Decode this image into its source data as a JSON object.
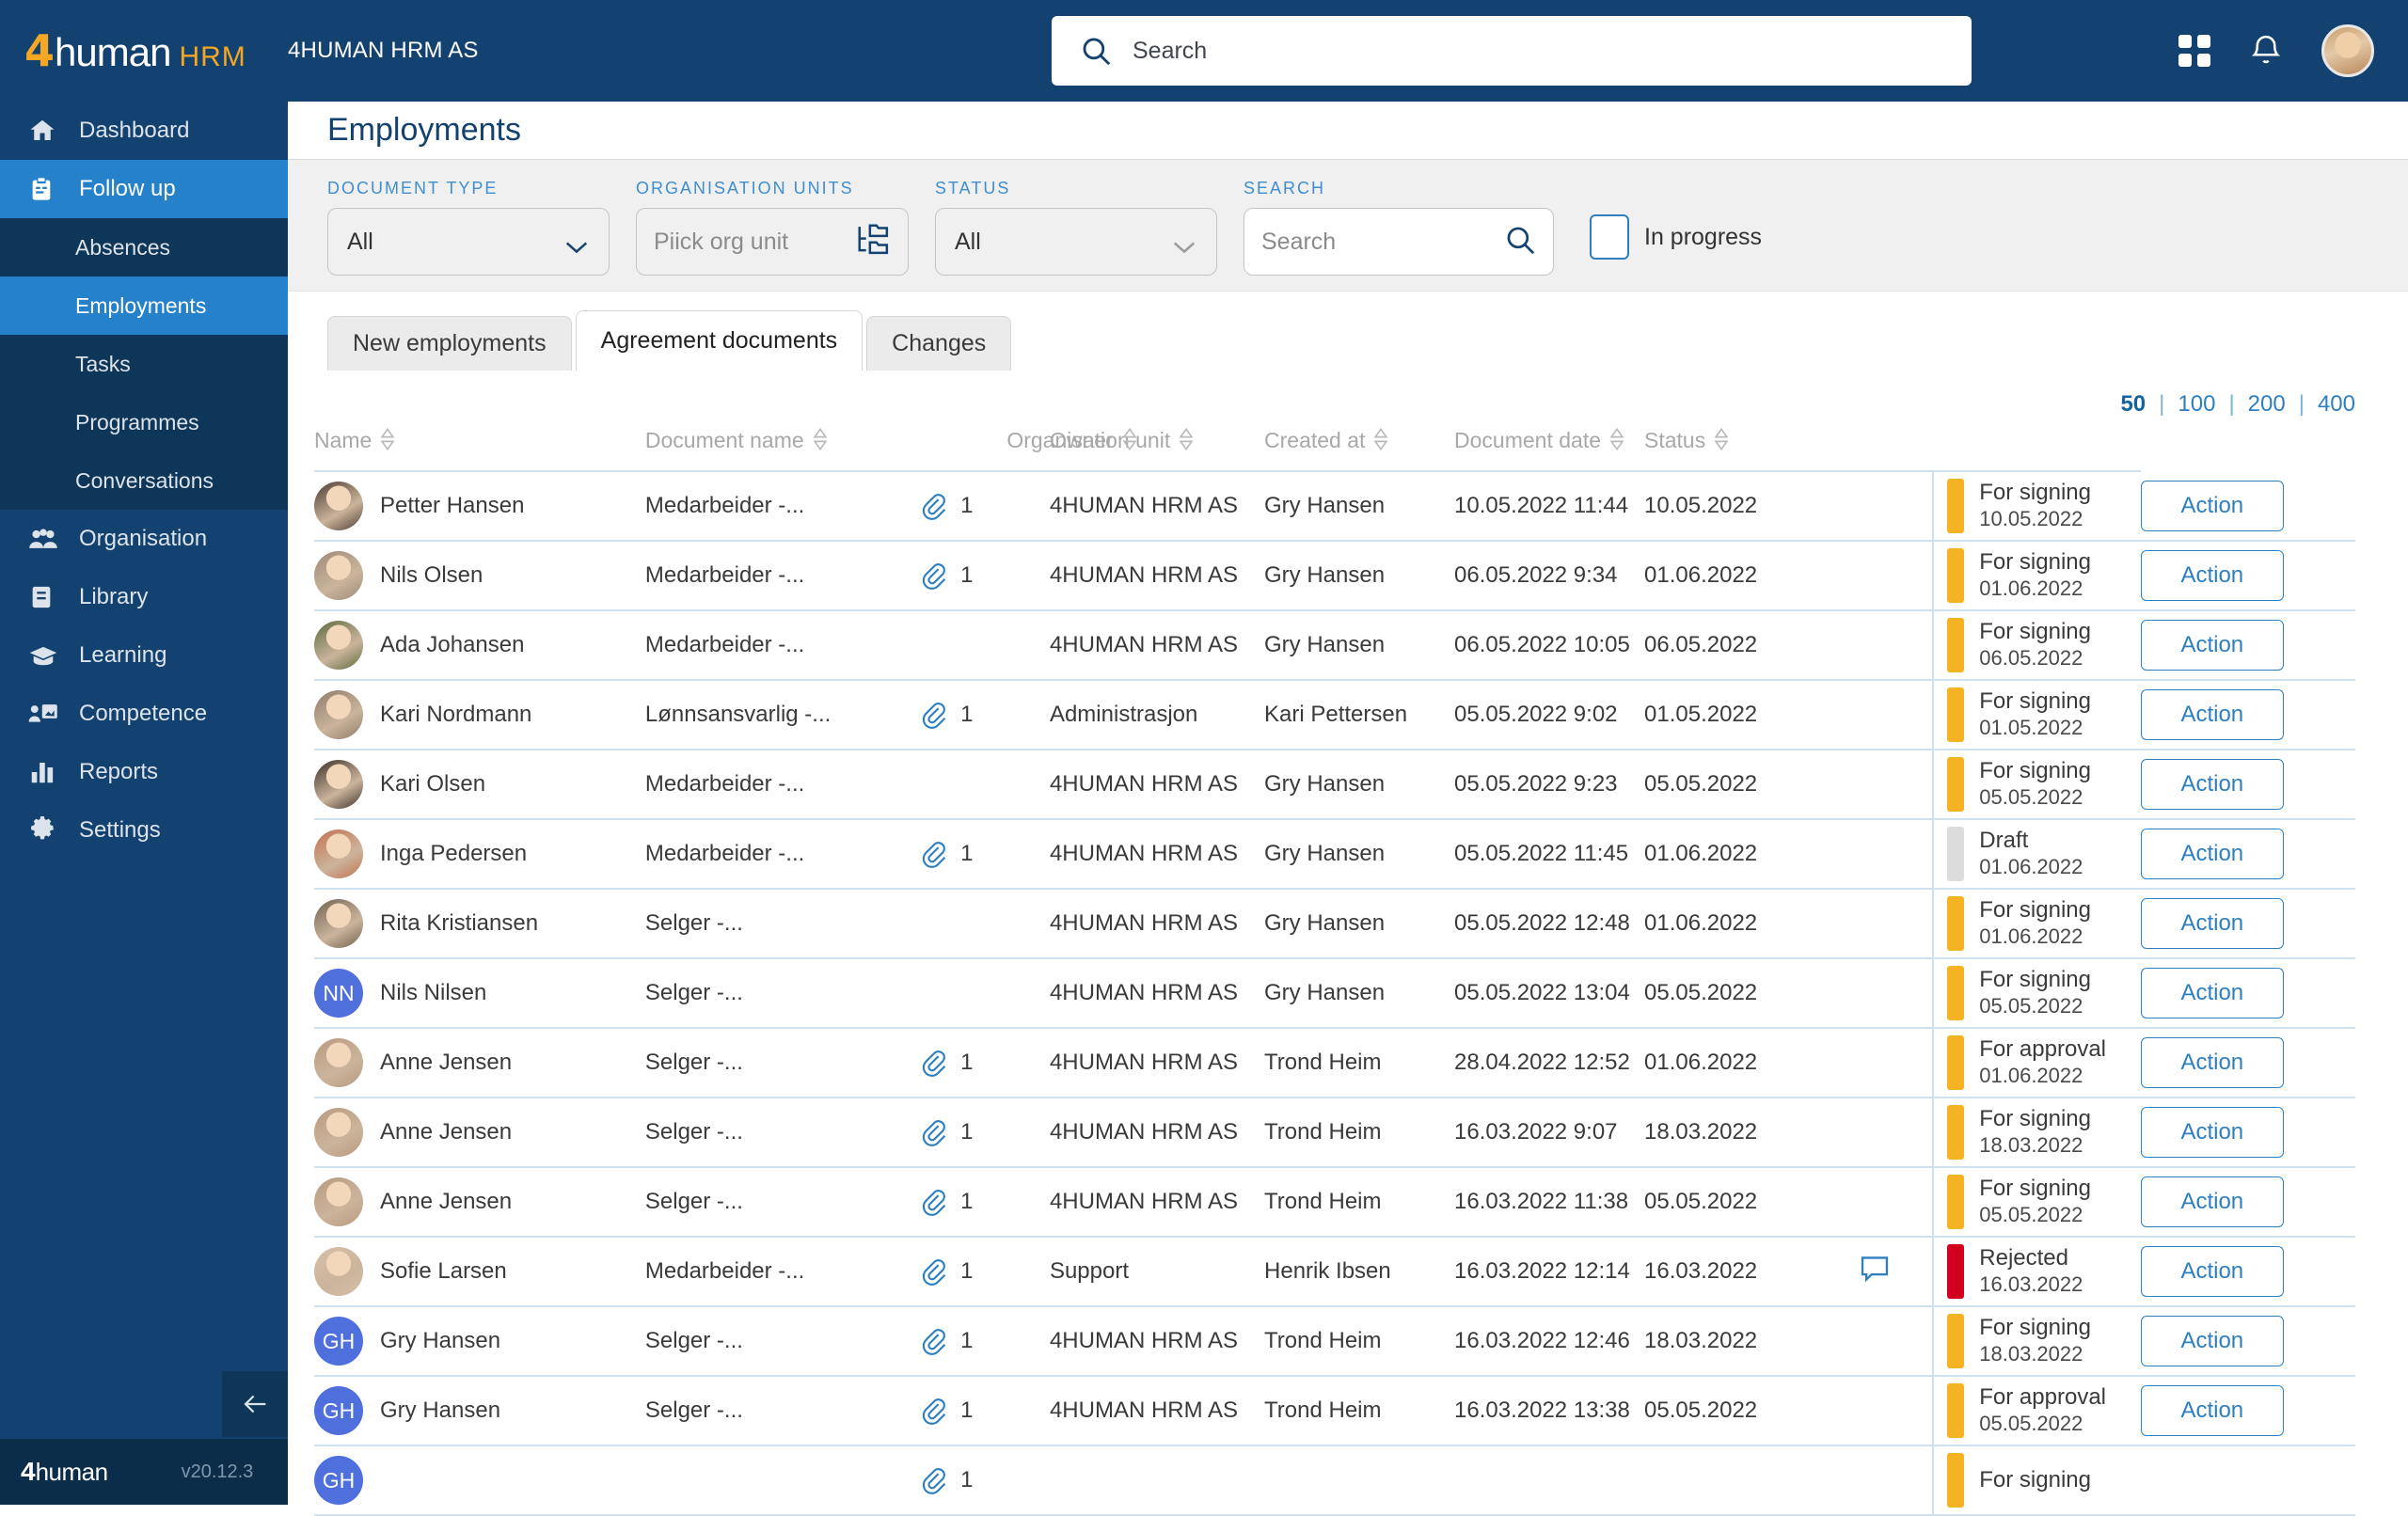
{
  "app": {
    "logo_4": "4",
    "logo_human": "human",
    "logo_hrm": "HRM",
    "org_name": "4HUMAN HRM AS",
    "version": "v20.12.3",
    "footer_logo_4": "4",
    "footer_logo_human": "human"
  },
  "topbar": {
    "search_placeholder": "Search",
    "search_value": ""
  },
  "sidebar": {
    "items": [
      {
        "label": "Dashboard",
        "icon": "home-icon",
        "active": false
      },
      {
        "label": "Follow up",
        "icon": "clipboard-icon",
        "active": true
      },
      {
        "label": "Organisation",
        "icon": "people-icon",
        "active": false
      },
      {
        "label": "Library",
        "icon": "book-icon",
        "active": false
      },
      {
        "label": "Learning",
        "icon": "graduation-cap-icon",
        "active": false
      },
      {
        "label": "Competence",
        "icon": "presentation-icon",
        "active": false
      },
      {
        "label": "Reports",
        "icon": "bar-chart-icon",
        "active": false
      },
      {
        "label": "Settings",
        "icon": "gear-icon",
        "active": false
      }
    ],
    "sub_items": [
      {
        "label": "Absences",
        "active": false
      },
      {
        "label": "Employments",
        "active": true
      },
      {
        "label": "Tasks",
        "active": false
      },
      {
        "label": "Programmes",
        "active": false
      },
      {
        "label": "Conversations",
        "active": false
      }
    ]
  },
  "page": {
    "title": "Employments"
  },
  "filters": {
    "document_type": {
      "label": "DOCUMENT TYPE",
      "value": "All"
    },
    "organisation_units": {
      "label": "ORGANISATION UNITS",
      "placeholder": "Piick org unit",
      "value": ""
    },
    "status": {
      "label": "STATUS",
      "value": "All"
    },
    "search": {
      "label": "SEARCH",
      "placeholder": "Search",
      "value": ""
    },
    "in_progress": {
      "label": "In progress",
      "checked": false
    }
  },
  "tabs": [
    {
      "label": "New  employments",
      "active": false
    },
    {
      "label": "Agreement documents",
      "active": true
    },
    {
      "label": "Changes",
      "active": false
    }
  ],
  "pager": {
    "options": [
      "50",
      "100",
      "200",
      "400"
    ],
    "selected": "50",
    "separator": "|"
  },
  "table": {
    "columns": [
      "Name",
      "Document name",
      "Organisation unit",
      "Owner",
      "Created at",
      "Document date",
      "Status"
    ],
    "rows": [
      {
        "avatar_type": "photo",
        "avatar_tone": "#4b3a30",
        "name": "Petter Hansen",
        "document_name": "Medarbeider -...",
        "attachments": "1",
        "has_attachment": true,
        "organisation_unit": "4HUMAN HRM AS",
        "owner": "Gry Hansen",
        "created_at": "10.05.2022 11:44",
        "document_date": "10.05.2022",
        "has_comment": false,
        "status_label": "For signing",
        "status_date": "10.05.2022",
        "status_color": "#f5b323",
        "action": "Action"
      },
      {
        "avatar_type": "photo",
        "avatar_tone": "#9c8a78",
        "name": "Nils Olsen",
        "document_name": "Medarbeider -...",
        "attachments": "1",
        "has_attachment": true,
        "organisation_unit": "4HUMAN HRM AS",
        "owner": "Gry Hansen",
        "created_at": "06.05.2022 9:34",
        "document_date": "01.06.2022",
        "has_comment": false,
        "status_label": "For signing",
        "status_date": "01.06.2022",
        "status_color": "#f5b323",
        "action": "Action"
      },
      {
        "avatar_type": "photo",
        "avatar_tone": "#5b6b3c",
        "name": "Ada Johansen",
        "document_name": "Medarbeider -...",
        "attachments": "",
        "has_attachment": false,
        "organisation_unit": "4HUMAN HRM AS",
        "owner": "Gry Hansen",
        "created_at": "06.05.2022 10:05",
        "document_date": "06.05.2022",
        "has_comment": false,
        "status_label": "For signing",
        "status_date": "06.05.2022",
        "status_color": "#f5b323",
        "action": "Action"
      },
      {
        "avatar_type": "photo",
        "avatar_tone": "#8d7b6a",
        "name": "Kari Nordmann",
        "document_name": "Lønnsansvarlig -...",
        "attachments": "1",
        "has_attachment": true,
        "organisation_unit": "Administrasjon",
        "owner": "Kari Pettersen",
        "created_at": "05.05.2022 9:02",
        "document_date": "01.05.2022",
        "has_comment": false,
        "status_label": "For signing",
        "status_date": "01.05.2022",
        "status_color": "#f5b323",
        "action": "Action"
      },
      {
        "avatar_type": "photo",
        "avatar_tone": "#3a2f28",
        "name": "Kari Olsen",
        "document_name": "Medarbeider -...",
        "attachments": "",
        "has_attachment": false,
        "organisation_unit": "4HUMAN HRM AS",
        "owner": "Gry Hansen",
        "created_at": "05.05.2022 9:23",
        "document_date": "05.05.2022",
        "has_comment": false,
        "status_label": "For signing",
        "status_date": "05.05.2022",
        "status_color": "#f5b323",
        "action": "Action"
      },
      {
        "avatar_type": "photo",
        "avatar_tone": "#c4714f",
        "name": "Inga Pedersen",
        "document_name": "Medarbeider -...",
        "attachments": "1",
        "has_attachment": true,
        "organisation_unit": "4HUMAN HRM AS",
        "owner": "Gry Hansen",
        "created_at": "05.05.2022 11:45",
        "document_date": "01.06.2022",
        "has_comment": false,
        "status_label": "Draft",
        "status_date": "01.06.2022",
        "status_color": "#dcdcdc",
        "action": "Action"
      },
      {
        "avatar_type": "photo",
        "avatar_tone": "#6f6150",
        "name": "Rita Kristiansen",
        "document_name": "Selger -...",
        "attachments": "",
        "has_attachment": false,
        "organisation_unit": "4HUMAN HRM AS",
        "owner": "Gry Hansen",
        "created_at": "05.05.2022 12:48",
        "document_date": "01.06.2022",
        "has_comment": false,
        "status_label": "For signing",
        "status_date": "01.06.2022",
        "status_color": "#f5b323",
        "action": "Action"
      },
      {
        "avatar_type": "initials",
        "avatar_initials": "NN",
        "name": "Nils Nilsen",
        "document_name": "Selger -...",
        "attachments": "",
        "has_attachment": false,
        "organisation_unit": "4HUMAN HRM AS",
        "owner": "Gry Hansen",
        "created_at": "05.05.2022 13:04",
        "document_date": "05.05.2022",
        "has_comment": false,
        "status_label": "For signing",
        "status_date": "05.05.2022",
        "status_color": "#f5b323",
        "action": "Action"
      },
      {
        "avatar_type": "photo",
        "avatar_tone": "#b99a7e",
        "name": "Anne Jensen",
        "document_name": "Selger -...",
        "attachments": "1",
        "has_attachment": true,
        "organisation_unit": "4HUMAN HRM AS",
        "owner": "Trond Heim",
        "created_at": "28.04.2022 12:52",
        "document_date": "01.06.2022",
        "has_comment": false,
        "status_label": "For approval",
        "status_date": "01.06.2022",
        "status_color": "#f5b323",
        "action": "Action"
      },
      {
        "avatar_type": "photo",
        "avatar_tone": "#b99a7e",
        "name": "Anne Jensen",
        "document_name": "Selger -...",
        "attachments": "1",
        "has_attachment": true,
        "organisation_unit": "4HUMAN HRM AS",
        "owner": "Trond Heim",
        "created_at": "16.03.2022 9:07",
        "document_date": "18.03.2022",
        "has_comment": false,
        "status_label": "For signing",
        "status_date": "18.03.2022",
        "status_color": "#f5b323",
        "action": "Action"
      },
      {
        "avatar_type": "photo",
        "avatar_tone": "#b99a7e",
        "name": "Anne Jensen",
        "document_name": "Selger -...",
        "attachments": "1",
        "has_attachment": true,
        "organisation_unit": "4HUMAN HRM AS",
        "owner": "Trond Heim",
        "created_at": "16.03.2022 11:38",
        "document_date": "05.05.2022",
        "has_comment": false,
        "status_label": "For signing",
        "status_date": "05.05.2022",
        "status_color": "#f5b323",
        "action": "Action"
      },
      {
        "avatar_type": "photo",
        "avatar_tone": "#d8c0a8",
        "name": "Sofie Larsen",
        "document_name": "Medarbeider -...",
        "attachments": "1",
        "has_attachment": true,
        "organisation_unit": "Support",
        "owner": "Henrik Ibsen",
        "created_at": "16.03.2022 12:14",
        "document_date": "16.03.2022",
        "has_comment": true,
        "status_label": "Rejected",
        "status_date": "16.03.2022",
        "status_color": "#d1001f",
        "action": "Action"
      },
      {
        "avatar_type": "initials",
        "avatar_initials": "GH",
        "name": "Gry Hansen",
        "document_name": "Selger -...",
        "attachments": "1",
        "has_attachment": true,
        "organisation_unit": "4HUMAN HRM AS",
        "owner": "Trond Heim",
        "created_at": "16.03.2022 12:46",
        "document_date": "18.03.2022",
        "has_comment": false,
        "status_label": "For signing",
        "status_date": "18.03.2022",
        "status_color": "#f5b323",
        "action": "Action"
      },
      {
        "avatar_type": "initials",
        "avatar_initials": "GH",
        "name": "Gry Hansen",
        "document_name": "Selger -...",
        "attachments": "1",
        "has_attachment": true,
        "organisation_unit": "4HUMAN HRM AS",
        "owner": "Trond Heim",
        "created_at": "16.03.2022 13:38",
        "document_date": "05.05.2022",
        "has_comment": false,
        "status_label": "For approval",
        "status_date": "05.05.2022",
        "status_color": "#f5b323",
        "action": "Action"
      },
      {
        "avatar_type": "initials",
        "avatar_initials": "GH",
        "name": "",
        "document_name": "",
        "attachments": "1",
        "has_attachment": true,
        "organisation_unit": "",
        "owner": "",
        "created_at": "",
        "document_date": "",
        "has_comment": false,
        "status_label": "For signing",
        "status_date": "",
        "status_color": "#f5b323",
        "action": ""
      }
    ]
  }
}
